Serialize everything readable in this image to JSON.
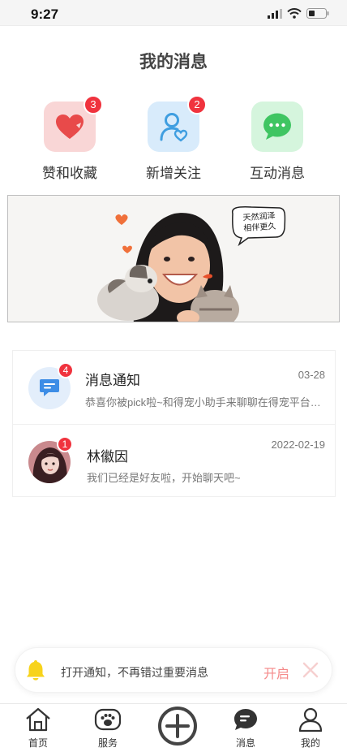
{
  "status": {
    "time": "9:27"
  },
  "page": {
    "title": "我的消息"
  },
  "quick": [
    {
      "label": "赞和收藏",
      "badge": "3",
      "icon": "heart-icon",
      "bg": "#f9d6d6",
      "color": "#e84a4a"
    },
    {
      "label": "新增关注",
      "badge": "2",
      "icon": "person-heart-icon",
      "bg": "#d8ebfb",
      "color": "#3f9ee0"
    },
    {
      "label": "互动消息",
      "badge": "",
      "icon": "chat-bubble-icon",
      "bg": "#d5f5dd",
      "color": "#3fc562"
    }
  ],
  "banner": {
    "caption_line1": "天然润泽",
    "caption_line2": "相伴更久"
  },
  "messages": [
    {
      "title": "消息通知",
      "time": "03-28",
      "preview": "恭喜你被pick啦~和得宠小助手来聊聊在得宠平台的乐趣吧",
      "badge": "4",
      "icon": "message-icon"
    },
    {
      "title": "林徽因",
      "time": "2022-02-19",
      "preview": "我们已经是好友啦，开始聊天吧~",
      "badge": "1",
      "icon": "avatar"
    }
  ],
  "notify": {
    "text": "打开通知，不再错过重要消息",
    "action": "开启",
    "icon": "bell-icon"
  },
  "tabs": [
    {
      "label": "首页",
      "icon": "home-icon"
    },
    {
      "label": "服务",
      "icon": "paw-icon"
    },
    {
      "label": "",
      "icon": "plus-circle-icon"
    },
    {
      "label": "消息",
      "icon": "message-tab-icon"
    },
    {
      "label": "我的",
      "icon": "user-icon"
    }
  ],
  "colors": {
    "badge": "#f0333e",
    "accent_open": "#f58a8a",
    "bell": "#f7d31b"
  }
}
